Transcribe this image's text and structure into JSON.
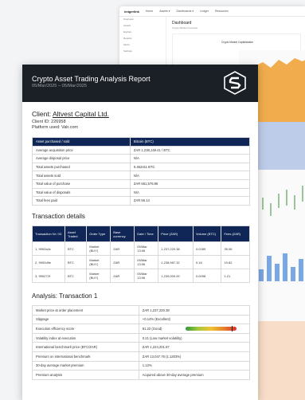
{
  "background_app": {
    "logo": "ledgerlink",
    "menu": [
      "Home",
      "Assets ▾",
      "Dashboards ▾",
      "Ledger",
      "Resources"
    ],
    "sidebar_items": [
      "Overview",
      "Assets",
      "Explore",
      "Reports",
      "Alerts",
      "Settings"
    ],
    "page_title": "Dashboard",
    "page_subtitle": "Crypto Market Overview",
    "chart_title": "Crypto Market Capitalization"
  },
  "report": {
    "title": "Crypto Asset Trading Analysis Report",
    "date_range": "05/Mar/2025 – 05/Mar/2025",
    "client_label": "Client: ",
    "client_name": "Altvest Capital Ltd.",
    "client_id": "Client ID: 226958",
    "platform": "Platform used: Valr.com",
    "summary": [
      [
        "Asset purchased / sold",
        "Bitcoin (BTC)"
      ],
      [
        "Average acquisition price",
        "ZAR 1,238,149.41 / BTC"
      ],
      [
        "Average disposal price",
        "N/A"
      ],
      [
        "Total assets purchased",
        "0.452411 BTC"
      ],
      [
        "Total assets sold",
        "N/A"
      ],
      [
        "Total value of purchase",
        "ZAR 561,576.95"
      ],
      [
        "Total value of disposals",
        "N/A"
      ],
      [
        "Total fees paid",
        "ZAR 56.14"
      ]
    ],
    "transaction_details_title": "Transaction details",
    "transaction_headers": [
      "Transaction Nr / ID",
      "Asset Traded",
      "Order Type",
      "Base currency",
      "Date / Time",
      "Price (ZAR)",
      "Volume (BTC)",
      "Fees (ZAR)"
    ],
    "transactions": [
      [
        "1, 9992a4c",
        "BTC",
        "Market (BUY)",
        "ZAR",
        "05/Mar 13:06",
        "1,237,220.38",
        "0.0289",
        "35.06"
      ],
      [
        "2, 9992d9e",
        "BTC",
        "Market (BUY)",
        "ZAR",
        "05/Mar 13:06",
        "1,238,987.32",
        "0.16",
        "19.82"
      ],
      [
        "3, 999272f",
        "BTC",
        "Market (BUY)",
        "ZAR",
        "05/Mar 13:06",
        "1,239,000.00",
        "0.0098",
        "1.21"
      ]
    ],
    "analysis_title": "Analysis: Transaction 1",
    "analysis": [
      [
        "Market price at order placement",
        "ZAR 1,237,220.38"
      ],
      [
        "Slippage",
        "+0.14% (Excellent)"
      ],
      [
        "Execution efficiency score",
        "91.22 (Good)"
      ],
      [
        "Volatility index at execution",
        "0.21 (Low market volatility)"
      ],
      [
        "International benchmark price (BTC/ZAR)",
        "ZAR 1,224,201.67"
      ],
      [
        "Premium on international benchmark",
        "ZAR 13,047.76 (1.1303%)"
      ],
      [
        "30-day average market premium",
        "1.12%"
      ],
      [
        "Premium analysis",
        "Acquired above 30-day average premium"
      ]
    ],
    "efficiency_score_fraction": 0.9122
  },
  "colors": {
    "header_dark": "#1b1f26",
    "table_head_navy": "#0f2656",
    "chart_orange": "#f0a43a",
    "chart_blue": "#4a78c8"
  }
}
